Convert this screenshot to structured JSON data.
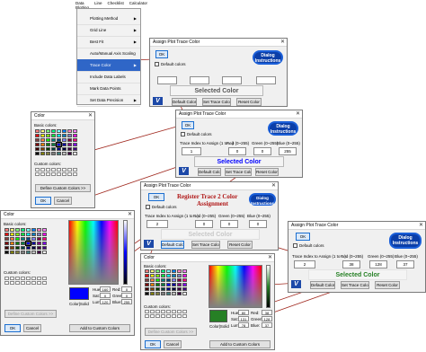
{
  "menubar": {
    "items": [
      "Data Plotting",
      "Line",
      "Checklist",
      "Calculator"
    ]
  },
  "menu": {
    "items": [
      {
        "label": "Plotting Method",
        "arrow": true
      },
      {
        "label": "Grid Line",
        "arrow": true
      },
      {
        "label": "Best Fit",
        "arrow": true
      },
      {
        "label": "Auto/Manual Axis Scaling",
        "arrow": false
      },
      {
        "label": "Trace Color",
        "arrow": true
      },
      {
        "label": "Include Data Labels",
        "arrow": false
      },
      {
        "label": "Mark Data Points",
        "arrow": false
      },
      {
        "label": "Set Data Precision",
        "arrow": true
      }
    ]
  },
  "dialog1": {
    "title": "Assign Plot Trace Color",
    "ok": "OK",
    "default_colors": "Default colors",
    "badge": "Dialog Instructions",
    "preview": "Selected Color",
    "buttons": [
      "Default Color",
      "Set Trace Color",
      "Reset Color"
    ]
  },
  "dialog2": {
    "title": "Assign Plot Trace Color",
    "ok": "OK",
    "default_colors": "Default colors",
    "badge": "Dialog Instructions",
    "trace_label": "Trace Index to Assign (1 to ...)",
    "red_label": "Red (0~255)",
    "green_label": "Green (0~255)",
    "blue_label": "Blue (0~255)",
    "values": [
      "1",
      "0",
      "0",
      "255"
    ],
    "preview": "Selected Color",
    "buttons": [
      "Default Color",
      "Set Trace Color",
      "Reset Color"
    ]
  },
  "dialog3": {
    "title": "Assign Plot Trace Color",
    "ok": "OK",
    "default_colors": "Default colors",
    "heading1": "Register Trace 2 Color",
    "heading2": "Assignment",
    "badge": "Dialog Instructions",
    "trace_label": "Trace Index to Assign (1 to ...)",
    "red_label": "Red (0~255)",
    "green_label": "Green (0~255)",
    "blue_label": "Blue (0~255)",
    "values": [
      "2",
      "0",
      "0",
      "0"
    ],
    "preview": "Selected Color",
    "buttons": [
      "Default Color",
      "Set Trace Color",
      "Reset Color"
    ]
  },
  "dialog4": {
    "title": "Assign Plot Trace Color",
    "ok": "OK",
    "default_colors": "Default colors",
    "badge": "Dialog Instructions",
    "trace_label": "Trace Index to Assign (1 to ...)",
    "red_label": "Red (0~255)",
    "green_label": "Green (0~255)",
    "blue_label": "Blue (0~255)",
    "values": [
      "2",
      "38",
      "128",
      "37"
    ],
    "preview": "Selected Color",
    "buttons": [
      "Default Color",
      "Set Trace Color",
      "Reset Color"
    ]
  },
  "color_small": {
    "title": "Color",
    "basic": "Basic colors:",
    "custom": "Custom colors:",
    "define": "Define Custom Colors >>",
    "ok": "OK",
    "cancel": "Cancel"
  },
  "color_big1": {
    "title": "Color",
    "basic": "Basic colors:",
    "custom": "Custom colors:",
    "define": "Define Custom Colors >>",
    "ok": "OK",
    "cancel": "Cancel",
    "add": "Add to Custom Colors",
    "colorsolid": "Color|Solid",
    "hue": "Hue:",
    "sat": "Sat:",
    "lum": "Lum:",
    "red": "Red:",
    "green": "Green:",
    "blue": "Blue:",
    "vals": [
      "160",
      "0",
      "120",
      "0",
      "0",
      "255"
    ]
  },
  "color_big2": {
    "title": "Color",
    "basic": "Basic colors:",
    "custom": "Custom colors:",
    "define": "Define Custom Colors >>",
    "ok": "OK",
    "cancel": "Cancel",
    "add": "Add to Custom Colors",
    "colorsolid": "Color|Solid",
    "hue": "Hue:",
    "sat": "Sat:",
    "lum": "Lum:",
    "red": "Red:",
    "green": "Green:",
    "blue": "Blue:",
    "vals": [
      "80",
      "131",
      "78",
      "38",
      "128",
      "37"
    ]
  },
  "colors": {
    "basic": [
      "#ff8080",
      "#ffff80",
      "#80ff80",
      "#00ff80",
      "#80ffff",
      "#0080ff",
      "#ff80c0",
      "#ff80ff",
      "#ff0000",
      "#ffff00",
      "#80ff00",
      "#00ff40",
      "#00ffff",
      "#0080c0",
      "#8080c0",
      "#ff00ff",
      "#804040",
      "#ff8040",
      "#00ff00",
      "#008080",
      "#004080",
      "#8080ff",
      "#800040",
      "#ff0080",
      "#800000",
      "#ff8000",
      "#008000",
      "#008040",
      "#0000ff",
      "#0000a0",
      "#800080",
      "#8000ff",
      "#400000",
      "#804000",
      "#004000",
      "#004040",
      "#000080",
      "#000040",
      "#400040",
      "#400080",
      "#000000",
      "#808000",
      "#808040",
      "#808080",
      "#408080",
      "#c0c0c0",
      "#400040",
      "#ffffff"
    ],
    "blue_sel": "#0000ff",
    "green_sel": "#268025",
    "badge_bg": "#0b3ea8",
    "heading_red": "#b01818",
    "arrow": "#a0281e"
  }
}
